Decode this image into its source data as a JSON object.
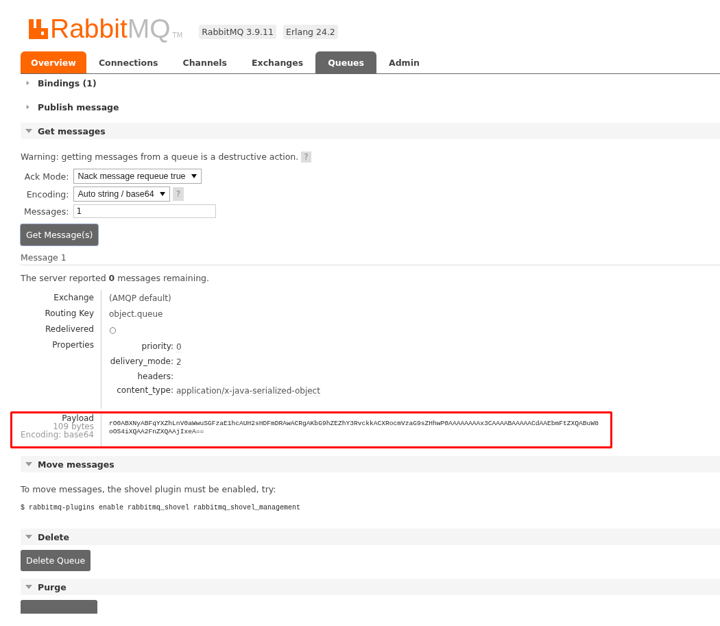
{
  "header": {
    "logo": {
      "brand": "Rabbit",
      "suffix": "MQ",
      "trademark": "TM"
    },
    "versions": [
      "RabbitMQ 3.9.11",
      "Erlang 24.2"
    ]
  },
  "tabs": [
    {
      "label": "Overview",
      "selected": false,
      "highlighted": true
    },
    {
      "label": "Connections",
      "selected": false,
      "highlighted": false
    },
    {
      "label": "Channels",
      "selected": false,
      "highlighted": false
    },
    {
      "label": "Exchanges",
      "selected": false,
      "highlighted": false
    },
    {
      "label": "Queues",
      "selected": true,
      "highlighted": false
    },
    {
      "label": "Admin",
      "selected": false,
      "highlighted": false
    }
  ],
  "sections": [
    {
      "title": "Bindings (1)",
      "expanded": false
    },
    {
      "title": "Publish message",
      "expanded": false
    },
    {
      "kind": "get",
      "title": "Get messages",
      "expanded": true,
      "warning": "Warning: getting messages from a queue is a destructive action.",
      "help": "?",
      "form": [
        {
          "kind": "select",
          "label": "Ack Mode:",
          "value": "Nack message requeue true"
        },
        {
          "kind": "select",
          "label": "Encoding:",
          "value": "Auto string / base64",
          "help": "?"
        },
        {
          "kind": "input",
          "label": "Messages:",
          "value": "1"
        }
      ],
      "button": "Get Message(s)",
      "message": {
        "title": "Message 1",
        "remaining": "The server reported **0** messages remaining.",
        "fields": [
          {
            "kind": "text",
            "label": "Exchange",
            "value": "(AMQP default)"
          },
          {
            "kind": "text",
            "label": "Routing Key",
            "value": "object.queue"
          },
          {
            "kind": "text",
            "label": "Redelivered",
            "value": "○"
          },
          {
            "kind": "properties",
            "label": "Properties",
            "properties": [
              {
                "key": "priority:",
                "value": "0"
              },
              {
                "key": "delivery_mode:",
                "value": "2"
              },
              {
                "key": "headers:"
              },
              {
                "key": "content_type:",
                "value": "application/x-java-serialized-object"
              }
            ]
          }
        ],
        "payload": {
          "label": "Payload",
          "size": "109 bytes",
          "encoding": "Encoding: base64",
          "value": "rO0ABXNyABFqYXZhLnV0aWwuSGFzaE1hcAUH2sHDFmDRAwACRgAKbG9hZEZhY3RvckkACXRocmVzaG9sZHhwP0AAAAAAAAx3CAAAABAAAAACdAAEbmFtZXQABuW8oOS4iXQAA2FnZXQAAjIxeA==",
          "highlighted": true
        }
      }
    },
    {
      "kind": "move",
      "title": "Move messages",
      "expanded": true,
      "text": "To move messages, the shovel plugin must be enabled, try:",
      "command": "$ rabbitmq-plugins enable rabbitmq_shovel rabbitmq_shovel_management"
    },
    {
      "kind": "delete",
      "title": "Delete",
      "expanded": true,
      "button": "Delete Queue"
    },
    {
      "kind": "purge",
      "title": "Purge",
      "expanded": true
    }
  ]
}
